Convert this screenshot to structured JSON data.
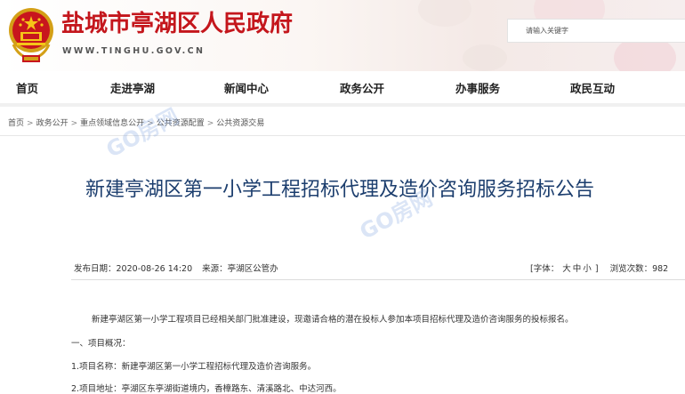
{
  "header": {
    "site_title": "盐城市亭湖区人民政府",
    "site_domain": "WWW.TINGHU.GOV.CN",
    "search_placeholder": "请输入关键字"
  },
  "nav": {
    "items": [
      {
        "label": "首页"
      },
      {
        "label": "走进亭湖"
      },
      {
        "label": "新闻中心"
      },
      {
        "label": "政务公开"
      },
      {
        "label": "办事服务"
      },
      {
        "label": "政民互动"
      }
    ]
  },
  "breadcrumb": {
    "items": [
      {
        "label": "首页"
      },
      {
        "label": "政务公开"
      },
      {
        "label": "重点领域信息公开"
      },
      {
        "label": "公共资源配置"
      },
      {
        "label": "公共资源交易"
      }
    ],
    "separator": ">"
  },
  "article": {
    "title": "新建亭湖区第一小学工程招标代理及造价咨询服务招标公告",
    "publish_label": "发布日期：",
    "publish_date": "2020-08-26 14:20",
    "source_label": "来源：",
    "source": "亭湖区公管办",
    "font_size_label": "[字体：",
    "font_large": "大",
    "font_medium": "中",
    "font_small": "小",
    "font_size_close": "]",
    "views_label": "浏览次数：",
    "views": "982",
    "paragraphs": [
      "新建亭湖区第一小学工程项目已经相关部门批准建设，现邀请合格的潜在投标人参加本项目招标代理及造价咨询服务的投标报名。",
      "一、项目概况：",
      "1.项目名称：新建亭湖区第一小学工程招标代理及造价咨询服务。",
      "2.项目地址：亭湖区东亭湖街道境内，香樟路东、清溪路北、中达河西。"
    ]
  },
  "watermark": "GO房网",
  "colors": {
    "brand_red": "#c4161c",
    "title_blue": "#1c3e6e"
  }
}
